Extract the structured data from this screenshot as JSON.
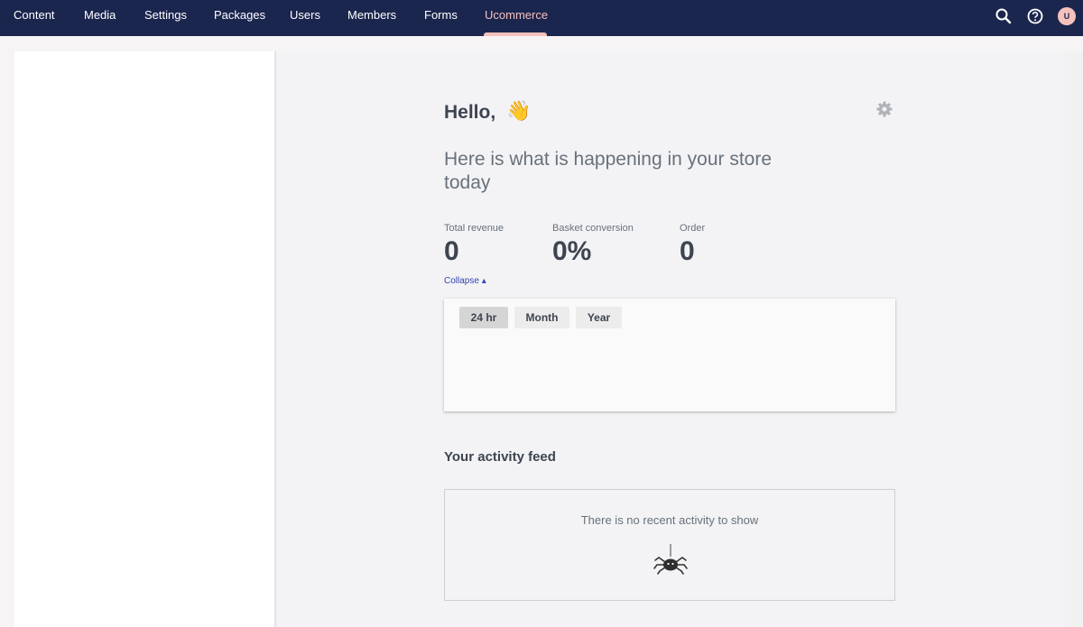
{
  "nav": {
    "items": [
      {
        "label": "Content"
      },
      {
        "label": "Media"
      },
      {
        "label": "Settings"
      },
      {
        "label": "Packages"
      },
      {
        "label": "Users"
      },
      {
        "label": "Members"
      },
      {
        "label": "Forms"
      },
      {
        "label": "Ucommerce",
        "active": true
      }
    ],
    "icons": [
      "search-icon",
      "help-icon"
    ],
    "avatar_initial": "U"
  },
  "dashboard": {
    "greeting": "Hello,",
    "greeting_emoji": "👋",
    "subtitle": "Here is what is happening in your store today",
    "stats": [
      {
        "label": "Total revenue",
        "value": "0"
      },
      {
        "label": "Basket conversion",
        "value": "0%"
      },
      {
        "label": "Order",
        "value": "0"
      }
    ],
    "collapse_label": "Collapse ▴",
    "periods": [
      {
        "label": "24 hr",
        "active": true
      },
      {
        "label": "Month"
      },
      {
        "label": "Year"
      }
    ],
    "feed_title": "Your activity feed",
    "feed_empty": "There is no recent activity to show"
  },
  "colors": {
    "topbar": "#1b264f",
    "accent": "#f5c1bc",
    "link": "#3544b1"
  }
}
